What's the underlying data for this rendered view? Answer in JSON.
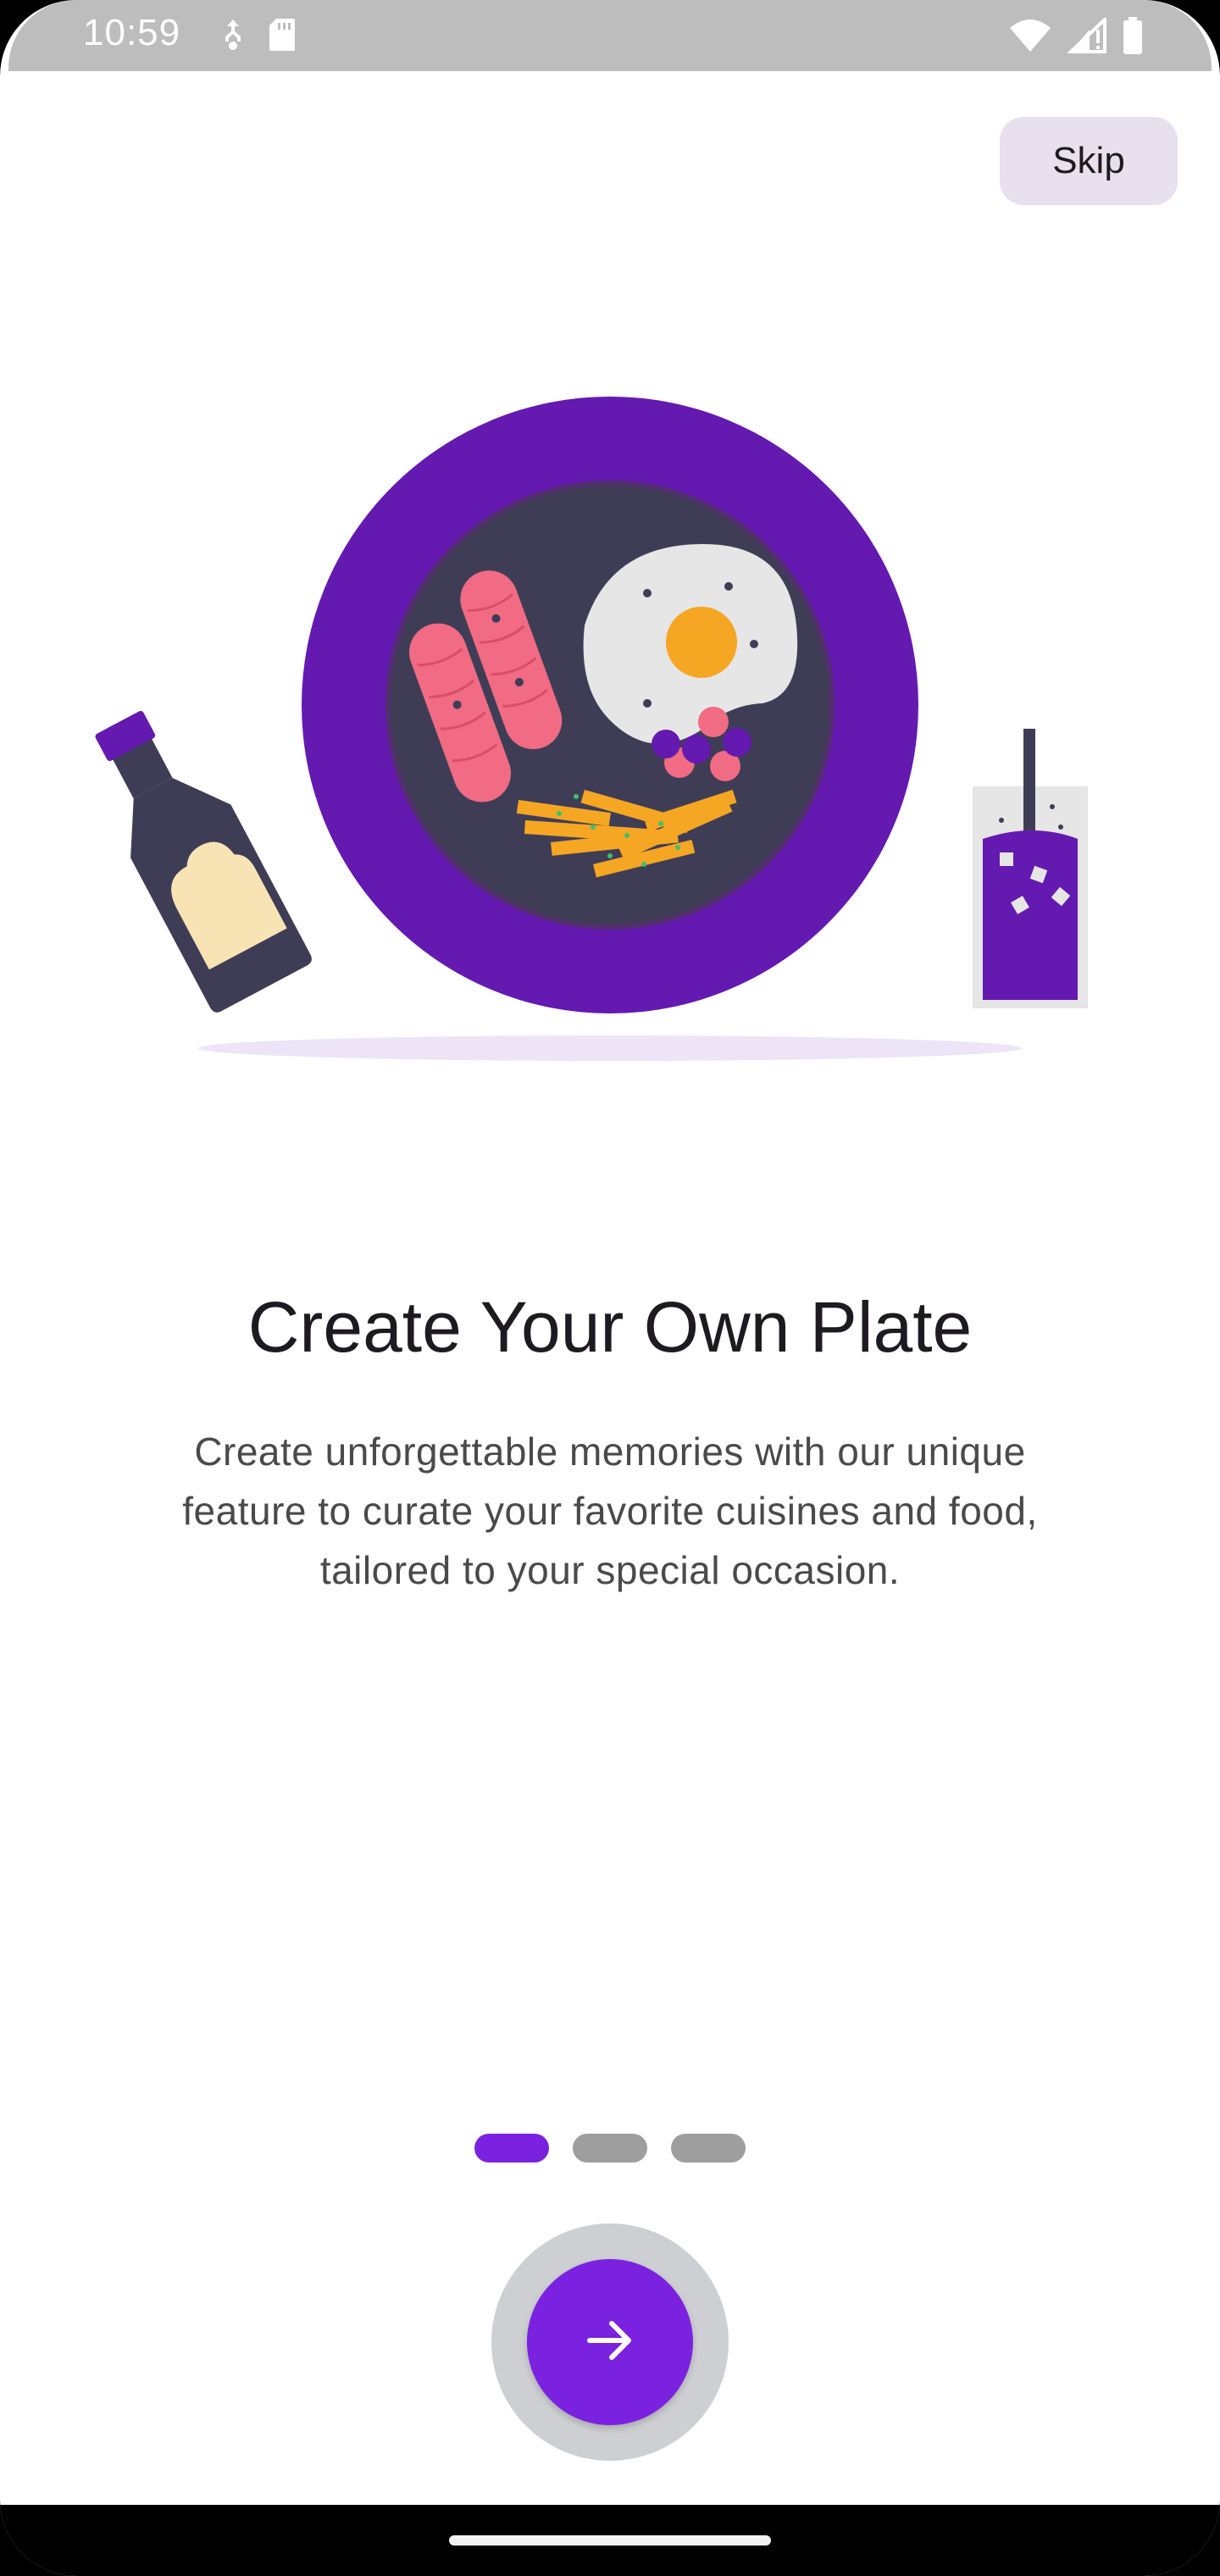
{
  "status_bar": {
    "time": "10:59",
    "left_icons": [
      "usb-debug-icon",
      "sd-card-icon"
    ],
    "right_icons": [
      "wifi-icon",
      "cellular-signal-icon",
      "battery-icon"
    ]
  },
  "header": {
    "skip_label": "Skip"
  },
  "onboarding": {
    "illustration": "plate-with-food-illustration",
    "title": "Create Your Own Plate",
    "description": "Create unforgettable memories with our unique feature to curate your favorite cuisines and food, tailored to your special occasion.",
    "page_indicator": {
      "current": 1,
      "total": 3
    }
  },
  "footer": {
    "next_icon": "arrow-right-icon"
  },
  "colors": {
    "accent": "#7b22e0",
    "plate": "#6419b0",
    "plate_inner": "#3f3d56",
    "skip_bg": "#e8e0ec",
    "indicator_inactive": "#9e9e9e"
  }
}
